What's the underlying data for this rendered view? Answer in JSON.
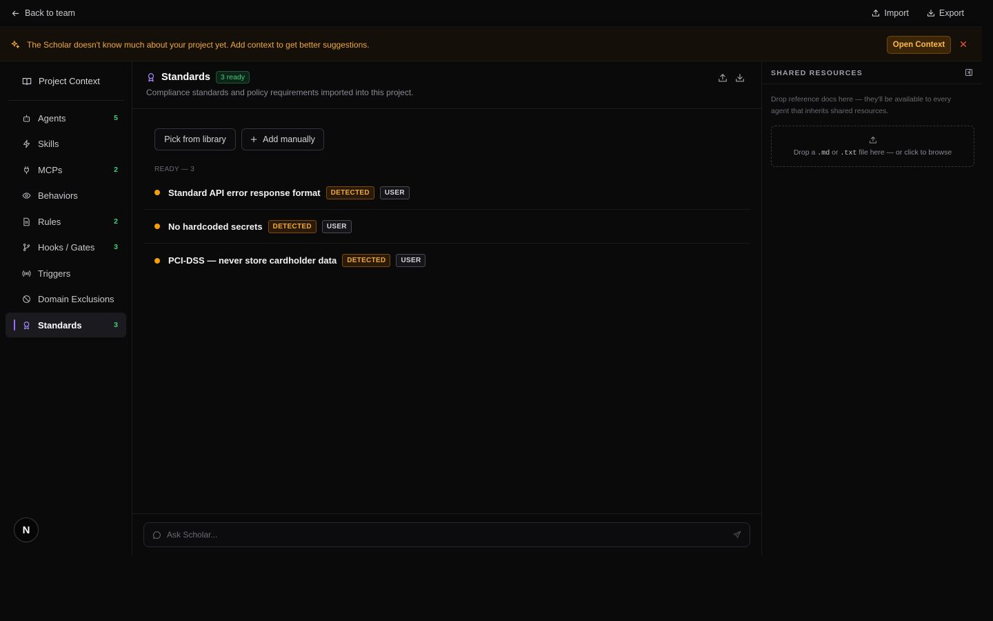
{
  "topbar": {
    "back_label": "Back to team",
    "import_label": "Import",
    "export_label": "Export"
  },
  "banner": {
    "message": "The Scholar doesn't know much about your project yet. Add context to get better suggestions.",
    "open_button": "Open Context"
  },
  "sidebar": {
    "project_context": "Project Context",
    "items": [
      {
        "label": "Agents",
        "count": "5",
        "icon": "bot-icon"
      },
      {
        "label": "Skills",
        "count": "",
        "icon": "bolt-icon"
      },
      {
        "label": "MCPs",
        "count": "2",
        "icon": "plug-icon"
      },
      {
        "label": "Behaviors",
        "count": "",
        "icon": "eye-icon"
      },
      {
        "label": "Rules",
        "count": "2",
        "icon": "document-icon"
      },
      {
        "label": "Hooks / Gates",
        "count": "3",
        "icon": "git-branch-icon"
      },
      {
        "label": "Triggers",
        "count": "",
        "icon": "broadcast-icon"
      },
      {
        "label": "Domain Exclusions",
        "count": "",
        "icon": "ban-icon"
      },
      {
        "label": "Standards",
        "count": "3",
        "icon": "award-icon",
        "active": true
      }
    ],
    "avatar_letter": "N"
  },
  "main": {
    "title": "Standards",
    "ready_badge": "3 ready",
    "subtitle": "Compliance standards and policy requirements imported into this project.",
    "pick_button": "Pick from library",
    "add_button": "Add manually",
    "section_label": "READY — 3",
    "standards": [
      {
        "name": "Standard API error response format",
        "tag1": "DETECTED",
        "tag2": "USER"
      },
      {
        "name": "No hardcoded secrets",
        "tag1": "DETECTED",
        "tag2": "USER"
      },
      {
        "name": "PCI-DSS — never store cardholder data",
        "tag1": "DETECTED",
        "tag2": "USER"
      }
    ],
    "chat_placeholder": "Ask Scholar..."
  },
  "right_panel": {
    "title": "SHARED RESOURCES",
    "description": "Drop reference docs here — they'll be available to every agent that inherits shared resources.",
    "drop_pre": "Drop a ",
    "drop_ext1": ".md",
    "drop_mid": " or ",
    "drop_ext2": ".txt",
    "drop_post": " file here — or click to browse"
  },
  "colors": {
    "accent": "#9b6dff",
    "warning": "#f0a93a",
    "success": "#3ecf7a",
    "background": "#0a0a0b"
  }
}
